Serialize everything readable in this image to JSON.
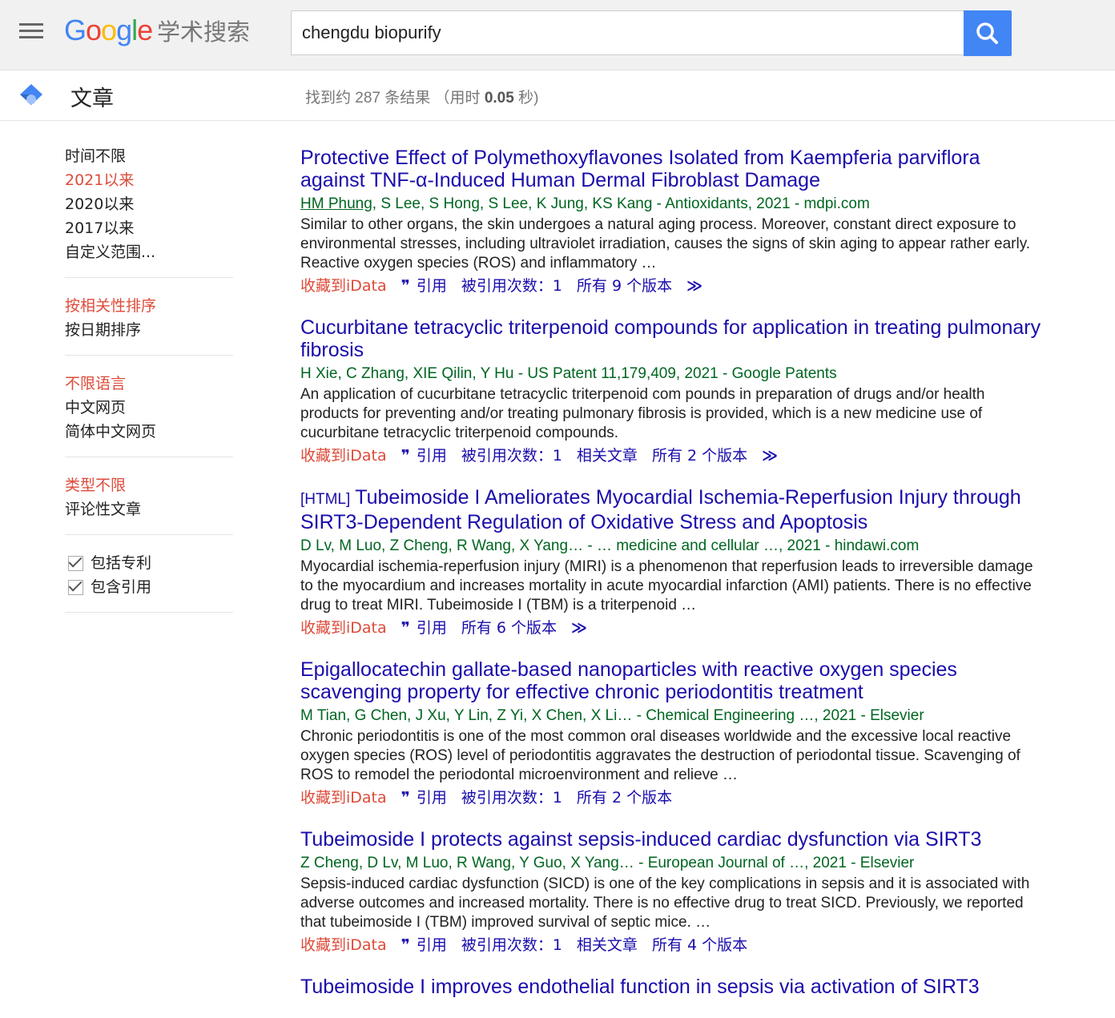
{
  "header": {
    "logo_letters": [
      "G",
      "o",
      "o",
      "g",
      "l",
      "e"
    ],
    "logo_sub": "学术搜索",
    "search_value": "chengdu biopurify",
    "icons": {
      "menu": "hamburger-icon",
      "search": "search-icon"
    },
    "accent_color": "#4285f4"
  },
  "subbar": {
    "section_title": "文章",
    "count_prefix": "找到约 287 条结果 （用时 ",
    "count_time": "0.05",
    "count_suffix": " 秒)"
  },
  "sidebar": {
    "time": [
      "时间不限",
      "2021以来",
      "2020以来",
      "2017以来",
      "自定义范围..."
    ],
    "sort": [
      "按相关性排序",
      "按日期排序"
    ],
    "lang": [
      "不限语言",
      "中文网页",
      "简体中文网页"
    ],
    "type": [
      "类型不限",
      "评论性文章"
    ],
    "checks": [
      "包括专利",
      "包含引用"
    ],
    "active_color": "#dd4b39"
  },
  "results": [
    {
      "prefix": "",
      "title": "Protective Effect of Polymethoxyflavones Isolated from Kaempferia parviflora against TNF-α-Induced Human Dermal Fibroblast Damage",
      "meta_link": "HM Phung",
      "meta": ", S Lee, S Hong, S Lee, K Jung, KS Kang - Antioxidants, 2021 - mdpi.com",
      "snippet": "Similar to other organs, the skin undergoes a natural aging process. Moreover, constant direct exposure to environmental stresses, including ultraviolet irradiation, causes the signs of skin aging to appear rather early. Reactive oxygen species (ROS) and inflammatory …",
      "save": "收藏到iData",
      "cite": "引用",
      "cited_by": "被引用次数：1",
      "related": "",
      "versions": "所有 9 个版本"
    },
    {
      "prefix": "",
      "title": "Cucurbitane tetracyclic triterpenoid compounds for application in treating pulmonary fibrosis",
      "meta_link": "",
      "meta": "H Xie, C Zhang, XIE Qilin, Y Hu - US Patent 11,179,409, 2021 - Google Patents",
      "snippet": "An application of cucurbitane tetracyclic triterpenoid com pounds in preparation of drugs and/or health products for preventing and/or treating pulmonary fibrosis is provided, which is a new medicine use of cucurbitane tetracyclic triterpenoid compounds.",
      "save": "收藏到iData",
      "cite": "引用",
      "cited_by": "被引用次数：1",
      "related": "相关文章",
      "versions": "所有 2 个版本"
    },
    {
      "prefix": "[HTML]",
      "title": "Tubeimoside I Ameliorates Myocardial Ischemia-Reperfusion Injury through SIRT3-Dependent Regulation of Oxidative Stress and Apoptosis",
      "meta_link": "",
      "meta": "D Lv, M Luo, Z Cheng, R Wang, X Yang… - … medicine and cellular …, 2021 - hindawi.com",
      "snippet": "Myocardial ischemia-reperfusion injury (MIRI) is a phenomenon that reperfusion leads to irreversible damage to the myocardium and increases mortality in acute myocardial infarction (AMI) patients. There is no effective drug to treat MIRI. Tubeimoside I (TBM) is a triterpenoid …",
      "save": "收藏到iData",
      "cite": "引用",
      "cited_by": "",
      "related": "",
      "versions": "所有 6 个版本"
    },
    {
      "prefix": "",
      "title": "Epigallocatechin gallate-based nanoparticles with reactive oxygen species scavenging property for effective chronic periodontitis treatment",
      "meta_link": "",
      "meta": "M Tian, G Chen, J Xu, Y Lin, Z Yi, X Chen, X Li… - Chemical Engineering …, 2021 - Elsevier",
      "snippet": "Chronic periodontitis is one of the most common oral diseases worldwide and the excessive local reactive oxygen species (ROS) level of periodontitis aggravates the destruction of periodontal tissue. Scavenging of ROS to remodel the periodontal microenvironment and relieve …",
      "save": "收藏到iData",
      "cite": "引用",
      "cited_by": "被引用次数：1",
      "related": "",
      "versions": "所有 2 个版本"
    },
    {
      "prefix": "",
      "title": "Tubeimoside I protects against sepsis-induced cardiac dysfunction via SIRT3",
      "meta_link": "",
      "meta": "Z Cheng, D Lv, M Luo, R Wang, Y Guo, X Yang… - European Journal of …, 2021 - Elsevier",
      "snippet": "Sepsis-induced cardiac dysfunction (SICD) is one of the key complications in sepsis and it is associated with adverse outcomes and increased mortality. There is no effective drug to treat SICD. Previously, we reported that tubeimoside I (TBM) improved survival of septic mice. …",
      "save": "收藏到iData",
      "cite": "引用",
      "cited_by": "被引用次数：1",
      "related": "相关文章",
      "versions": "所有 4 个版本"
    },
    {
      "prefix": "",
      "title": "Tubeimoside I improves endothelial function in sepsis via activation of SIRT3",
      "meta_link": "",
      "meta": "",
      "snippet": "",
      "save": "",
      "cite": "",
      "cited_by": "",
      "related": "",
      "versions": ""
    }
  ]
}
